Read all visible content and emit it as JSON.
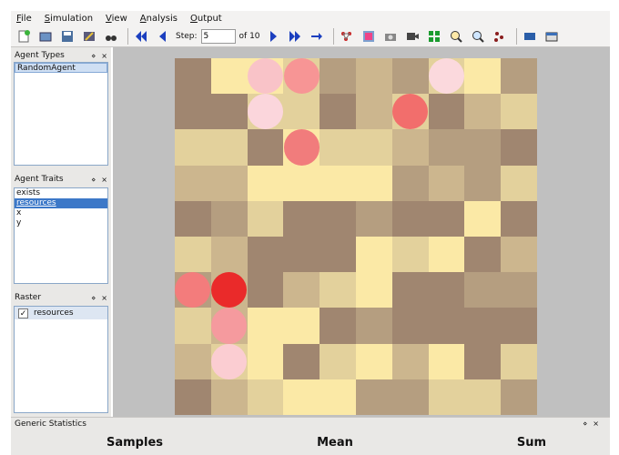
{
  "menubar": {
    "items": [
      {
        "key": "file",
        "first": "F",
        "rest": "ile"
      },
      {
        "key": "simulation",
        "first": "S",
        "rest": "imulation"
      },
      {
        "key": "view",
        "first": "V",
        "rest": "iew"
      },
      {
        "key": "analysis",
        "first": "A",
        "rest": "nalysis"
      },
      {
        "key": "output",
        "first": "O",
        "rest": "utput"
      }
    ]
  },
  "toolbar": {
    "step_label": "Step:",
    "step_value": "5",
    "step_of": "of 10"
  },
  "agent_types": {
    "title": "Agent Types",
    "items": [
      "RandomAgent"
    ]
  },
  "agent_traits": {
    "title": "Agent Traits",
    "items": [
      "exists",
      "resources",
      "x",
      "y"
    ]
  },
  "raster": {
    "title": "Raster",
    "layer": "resources",
    "checked": "✓"
  },
  "panel_controls": {
    "float": "⋄",
    "close": "×"
  },
  "statistics": {
    "title": "Generic Statistics",
    "columns": [
      "Samples",
      "Mean",
      "Sum"
    ]
  },
  "colors": {
    "c1": "#a08670",
    "c2": "#b59e80",
    "c3": "#ccb68e",
    "c4": "#e3d19c",
    "c5": "#fbe9a6"
  },
  "grid": {
    "rows": 10,
    "cols": 10,
    "cells": [
      [
        1,
        5,
        5,
        4,
        2,
        3,
        2,
        4,
        5,
        2
      ],
      [
        1,
        1,
        4,
        4,
        1,
        3,
        4,
        1,
        3,
        4
      ],
      [
        4,
        4,
        1,
        5,
        4,
        4,
        3,
        2,
        2,
        1
      ],
      [
        3,
        3,
        5,
        5,
        5,
        5,
        2,
        3,
        2,
        4
      ],
      [
        1,
        2,
        4,
        1,
        1,
        2,
        1,
        1,
        5,
        1
      ],
      [
        4,
        3,
        1,
        1,
        1,
        5,
        4,
        5,
        1,
        3
      ],
      [
        2,
        3,
        1,
        3,
        4,
        5,
        1,
        1,
        2,
        2
      ],
      [
        4,
        3,
        5,
        5,
        1,
        2,
        1,
        1,
        1,
        1
      ],
      [
        3,
        4,
        5,
        1,
        4,
        5,
        3,
        5,
        1,
        4
      ],
      [
        1,
        3,
        4,
        5,
        5,
        2,
        2,
        4,
        4,
        2
      ]
    ],
    "agents": [
      {
        "row": 0,
        "col": 2,
        "color": "#f9c3c8"
      },
      {
        "row": 0,
        "col": 3,
        "color": "#f79595"
      },
      {
        "row": 0,
        "col": 7,
        "color": "#fbd9dd"
      },
      {
        "row": 1,
        "col": 2,
        "color": "#fbd6dc"
      },
      {
        "row": 1,
        "col": 6,
        "color": "#f26e6c"
      },
      {
        "row": 2,
        "col": 3,
        "color": "#f17c7c"
      },
      {
        "row": 6,
        "col": 0,
        "color": "#f37c7c"
      },
      {
        "row": 6,
        "col": 1,
        "color": "#ea2a2a"
      },
      {
        "row": 7,
        "col": 1,
        "color": "#f59a9e"
      },
      {
        "row": 8,
        "col": 1,
        "color": "#fbcdd2"
      }
    ]
  }
}
